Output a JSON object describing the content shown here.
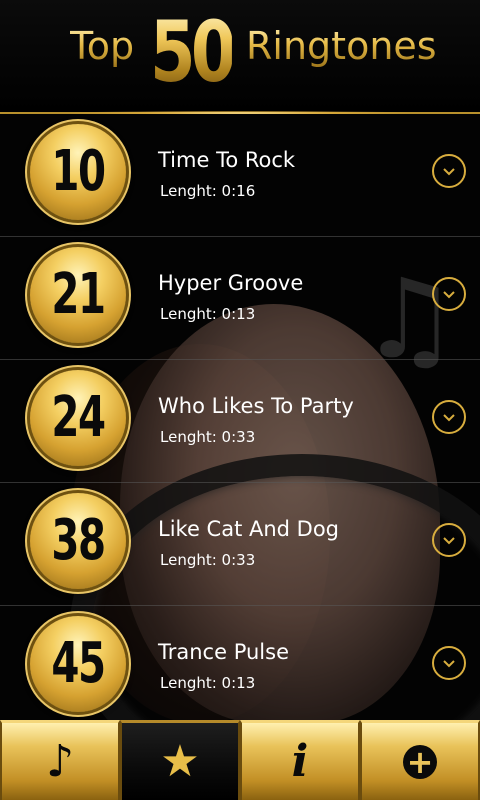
{
  "header": {
    "title_left": "Top",
    "title_number": "50",
    "title_right": "Ringtones"
  },
  "ringtones": [
    {
      "rank": "10",
      "title": "Time To Rock",
      "length": "Lenght: 0:16"
    },
    {
      "rank": "21",
      "title": "Hyper Groove",
      "length": "Lenght: 0:13"
    },
    {
      "rank": "24",
      "title": "Who Likes To Party",
      "length": "Lenght: 0:33"
    },
    {
      "rank": "38",
      "title": "Like Cat And Dog",
      "length": "Lenght: 0:33"
    },
    {
      "rank": "45",
      "title": "Trance Pulse",
      "length": "Lenght: 0:13"
    }
  ],
  "tabs": [
    {
      "icon": "music-note-icon",
      "glyph": "♪",
      "active": false
    },
    {
      "icon": "star-icon",
      "glyph": "★",
      "active": true
    },
    {
      "icon": "info-icon",
      "glyph": "i",
      "active": false
    },
    {
      "icon": "plus-circle-icon",
      "glyph": "+",
      "active": false
    }
  ],
  "colors": {
    "gold": "#e3b94b",
    "dark_gold": "#8a6210",
    "background": "#050505"
  }
}
